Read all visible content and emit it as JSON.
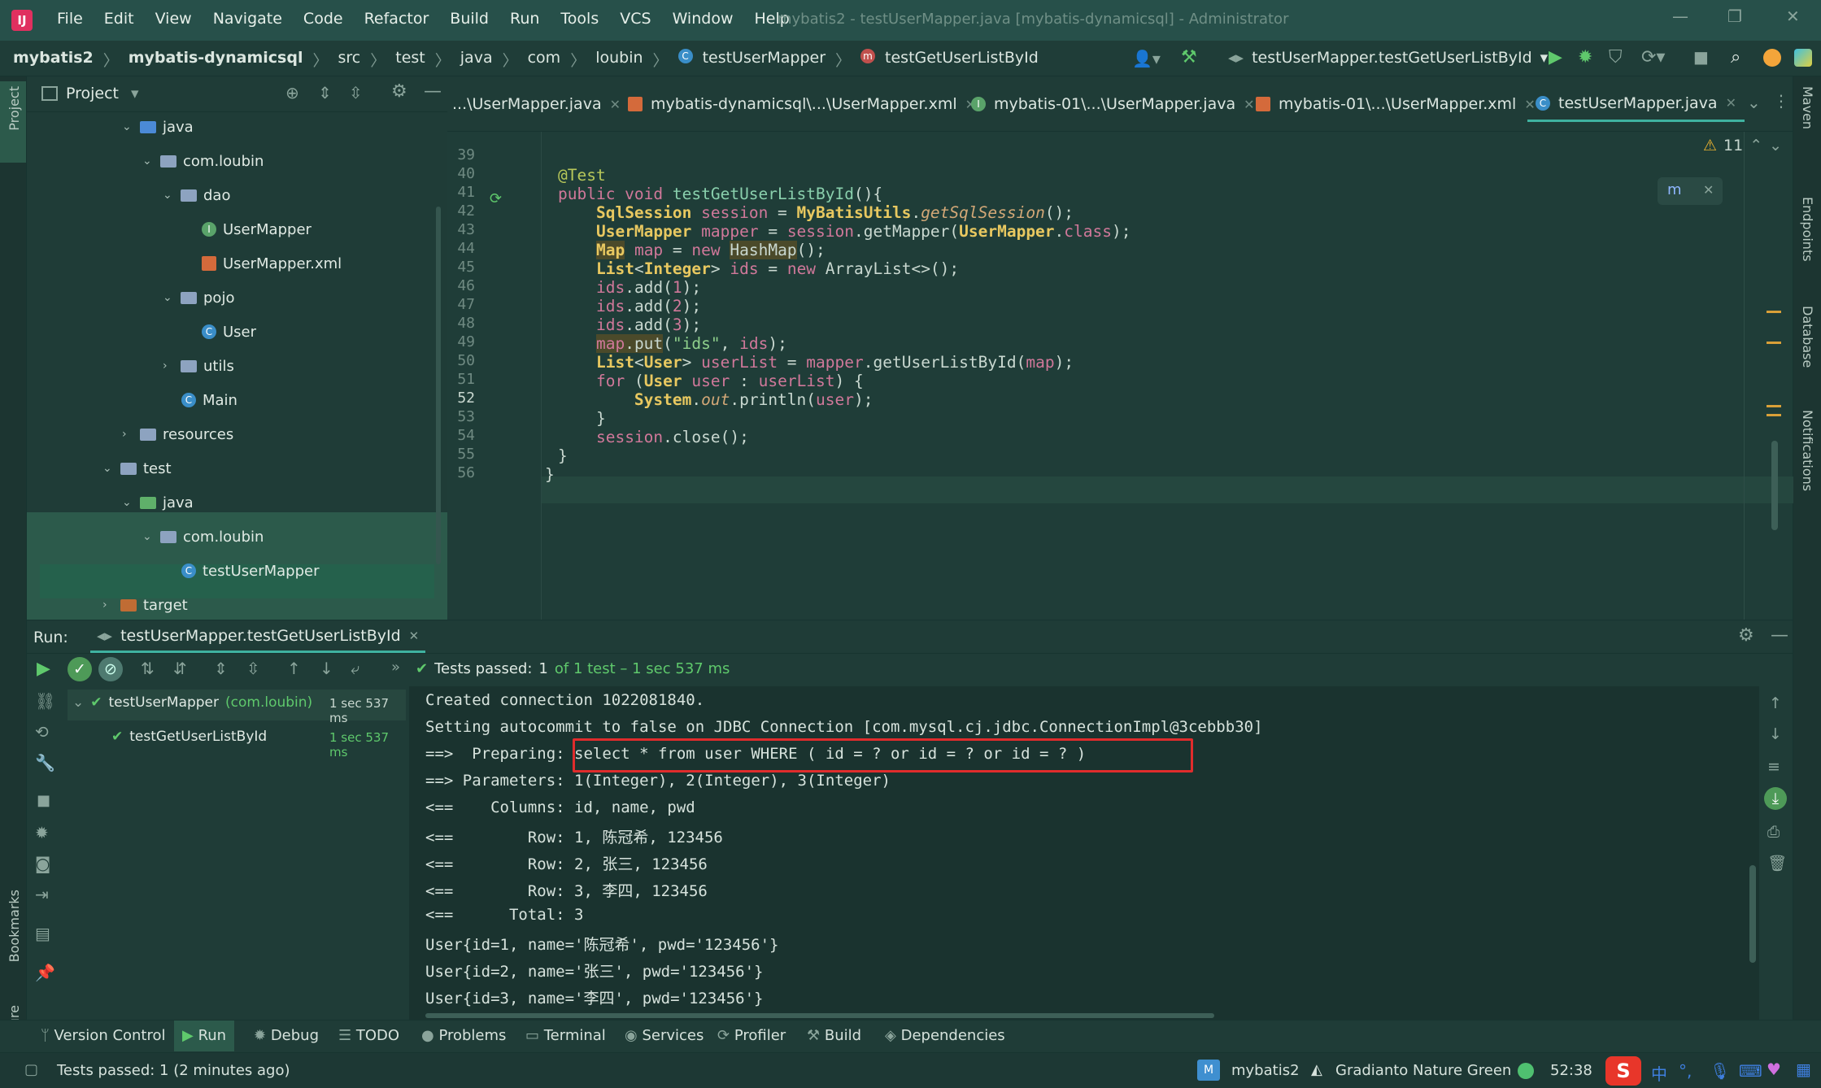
{
  "menubar": {
    "logo": "IJ",
    "items": [
      "File",
      "Edit",
      "View",
      "Navigate",
      "Code",
      "Refactor",
      "Build",
      "Run",
      "Tools",
      "VCS",
      "Window",
      "Help"
    ],
    "window_title": "mybatis2 - testUserMapper.java [mybatis-dynamicsql] - Administrator"
  },
  "breadcrumb": [
    "mybatis2",
    "mybatis-dynamicsql",
    "src",
    "test",
    "java",
    "com",
    "loubin",
    "testUserMapper",
    "testGetUserListById"
  ],
  "run_config": "testUserMapper.testGetUserListById",
  "project": {
    "title": "Project",
    "tree": [
      {
        "label": "java",
        "kind": "folder-blue"
      },
      {
        "label": "com.loubin",
        "kind": "package"
      },
      {
        "label": "dao",
        "kind": "package"
      },
      {
        "label": "UserMapper",
        "kind": "interface"
      },
      {
        "label": "UserMapper.xml",
        "kind": "xml"
      },
      {
        "label": "pojo",
        "kind": "package"
      },
      {
        "label": "User",
        "kind": "class"
      },
      {
        "label": "utils",
        "kind": "package"
      },
      {
        "label": "Main",
        "kind": "class"
      },
      {
        "label": "resources",
        "kind": "folder"
      },
      {
        "label": "test",
        "kind": "folder"
      },
      {
        "label": "java",
        "kind": "folder-green"
      },
      {
        "label": "com.loubin",
        "kind": "package"
      },
      {
        "label": "testUserMapper",
        "kind": "class"
      },
      {
        "label": "target",
        "kind": "folder-orange"
      }
    ]
  },
  "tabs": [
    {
      "label": "...\\UserMapper.java"
    },
    {
      "label": "mybatis-dynamicsql\\...\\UserMapper.xml"
    },
    {
      "label": "mybatis-01\\...\\UserMapper.java"
    },
    {
      "label": "mybatis-01\\...\\UserMapper.xml"
    },
    {
      "label": "testUserMapper.java"
    }
  ],
  "editor": {
    "warnings": "11",
    "line_numbers": [
      "39",
      "40",
      "41",
      "42",
      "43",
      "44",
      "45",
      "46",
      "47",
      "48",
      "49",
      "50",
      "51",
      "52",
      "53",
      "54",
      "55",
      "56"
    ],
    "current_line": "52"
  },
  "run": {
    "label": "Run:",
    "tab": "testUserMapper.testGetUserListById",
    "status_passed": "Tests passed:",
    "status_count": "1",
    "status_rest": "of 1 test – 1 sec 537 ms",
    "tests": [
      {
        "name": "testUserMapper",
        "pkg": "(com.loubin)",
        "time": "1 sec 537 ms"
      },
      {
        "name": "testGetUserListById",
        "pkg": "",
        "time": "1 sec 537 ms"
      }
    ],
    "console": [
      "Created connection 1022081840.",
      "Setting autocommit to false on JDBC Connection [com.mysql.cj.jdbc.ConnectionImpl@3cebbb30]",
      "==>  Preparing: select * from user WHERE ( id = ? or id = ? or id = ? )",
      "==> Parameters: 1(Integer), 2(Integer), 3(Integer)",
      "<==    Columns: id, name, pwd",
      "<==        Row: 1, 陈冠希, 123456",
      "<==        Row: 2, 张三, 123456",
      "<==        Row: 3, 李四, 123456",
      "<==      Total: 3",
      "User{id=1, name='陈冠希', pwd='123456'}",
      "User{id=2, name='张三', pwd='123456'}",
      "User{id=3, name='李四', pwd='123456'}"
    ]
  },
  "toolwindows": [
    "Version Control",
    "Run",
    "Debug",
    "TODO",
    "Problems",
    "Terminal",
    "Services",
    "Profiler",
    "Build",
    "Dependencies"
  ],
  "statusbar": {
    "message": "Tests passed: 1 (2 minutes ago)",
    "project": "mybatis2",
    "theme": "Gradianto Nature Green",
    "position": "52:38",
    "ime": "中"
  },
  "side_labels": {
    "left_top": "Project",
    "left_bookmarks": "Bookmarks",
    "left_structure": "Structure",
    "right": [
      "Maven",
      "Endpoints",
      "Database",
      "Notifications"
    ]
  }
}
